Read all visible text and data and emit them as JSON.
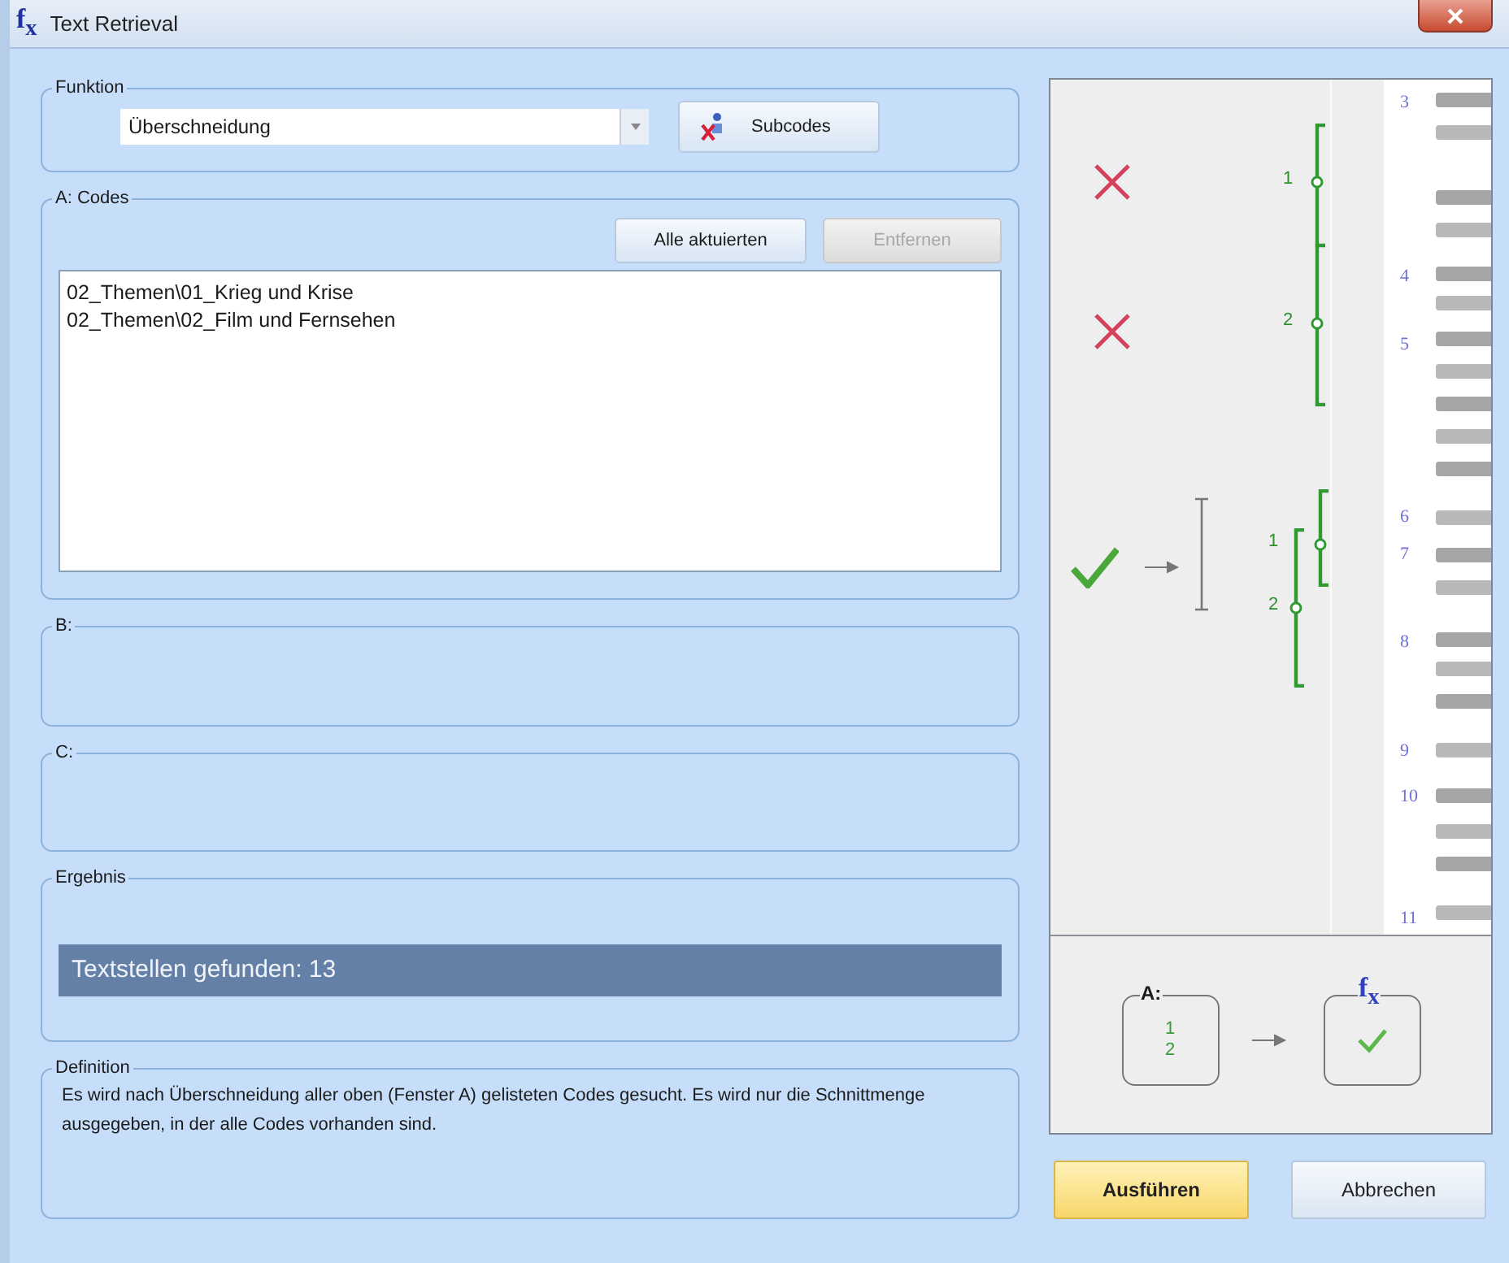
{
  "window": {
    "icon": "f$_{x}$",
    "title": "Text Retrieval"
  },
  "funktion": {
    "label": "Funktion",
    "value": "Überschneidung",
    "subcodes_button": "Subcodes"
  },
  "codes": {
    "label": "A: Codes",
    "buttons": [
      {
        "label": "Alle aktuierten",
        "disabled": false
      },
      {
        "label": "Entfernen",
        "disabled": true
      }
    ],
    "items": [
      "02_Themen\\01_Krieg und Krise",
      "02_Themen\\02_Film und Fernsehen"
    ]
  },
  "group_b": {
    "label": "B:"
  },
  "group_c": {
    "label": "C:"
  },
  "ergebnis": {
    "label": "Ergebnis",
    "result": "Textstellen gefunden: 13"
  },
  "definition": {
    "label": "Definition",
    "text": "Es wird nach Überschneidung aller oben (Fenster A) gelisteten Codes gesucht. Es wird nur die Schnittmenge ausgegeben, in der alle Codes vorhanden sind."
  },
  "preview": {
    "line_numbers": [
      "3",
      "4",
      "5",
      "6",
      "7",
      "8",
      "9",
      "10",
      "11"
    ],
    "cases": [
      {
        "kind": "miss",
        "labels": [
          "1"
        ]
      },
      {
        "kind": "miss",
        "labels": [
          "2"
        ]
      },
      {
        "kind": "hit",
        "labels": [
          "1",
          "2"
        ]
      }
    ],
    "formula": {
      "input_label": "A:",
      "codes": [
        "1",
        "2"
      ],
      "result_label": "f$_{x}$"
    }
  },
  "buttons": [
    {
      "label": "Ausführen",
      "default": true
    },
    {
      "label": "Abbrechen",
      "default": false
    }
  ]
}
